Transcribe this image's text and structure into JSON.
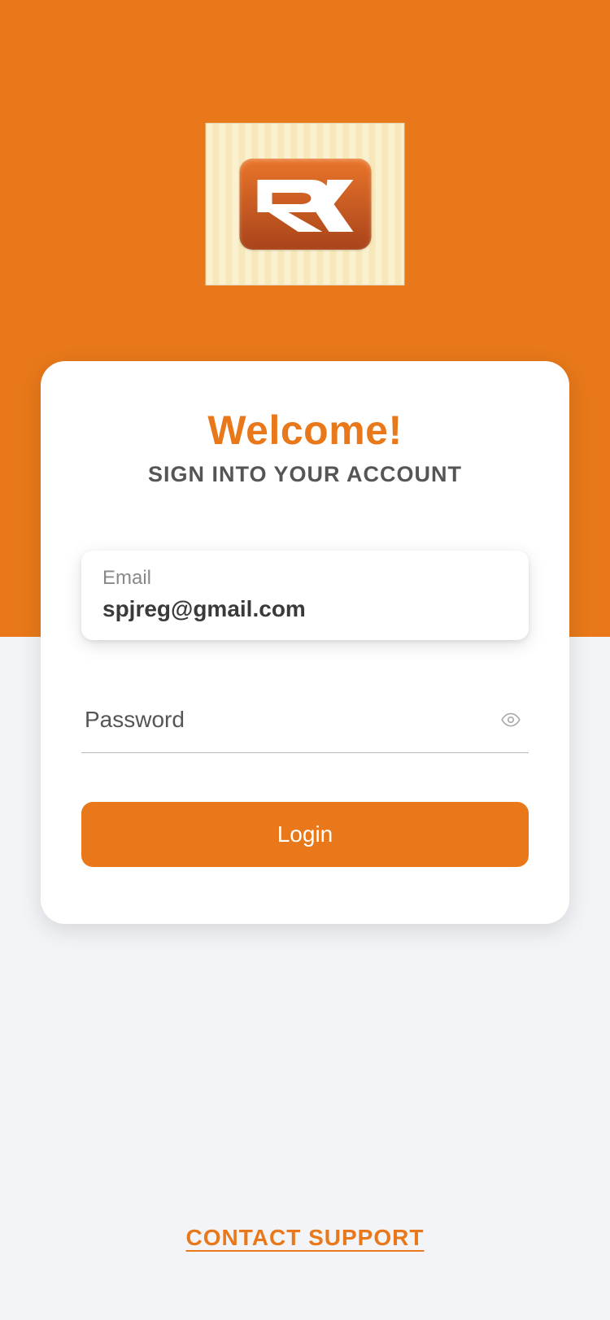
{
  "header": {
    "welcome": "Welcome!",
    "subtitle": "SIGN INTO YOUR ACCOUNT"
  },
  "form": {
    "email": {
      "label": "Email",
      "value": "spjreg@gmail.com"
    },
    "password": {
      "placeholder": "Password",
      "value": ""
    },
    "login_button": "Login"
  },
  "footer": {
    "contact_support": "CONTACT SUPPORT"
  },
  "colors": {
    "accent": "#e8781a"
  }
}
